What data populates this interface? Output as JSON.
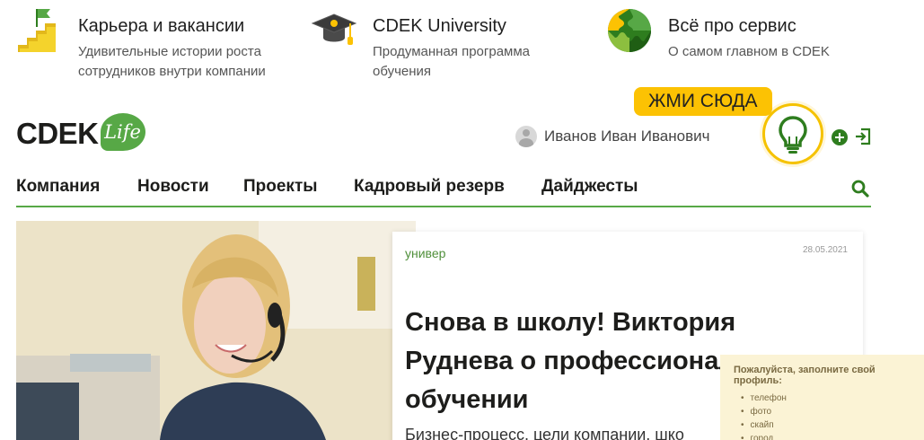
{
  "promos": [
    {
      "title": "Карьера и вакансии",
      "line1": "Удивительные истории роста",
      "line2": "сотрудников внутри компании",
      "icon": "stairs-flag-icon"
    },
    {
      "title": "CDEK University",
      "line1": "Продуманная программа",
      "line2": "обучения",
      "icon": "graduation-cap-icon"
    },
    {
      "title": "Всё про сервис",
      "line1": "О самом главном в CDEK",
      "line2": "",
      "icon": "puzzle-globe-icon"
    }
  ],
  "header": {
    "logo_text": "CDEK",
    "logo_badge": "Life",
    "user_name": "Иванов Иван Иванович",
    "tip_button": "ЖМИ СЮДА"
  },
  "nav": {
    "items": [
      "Компания",
      "Новости",
      "Проекты",
      "Кадровый резерв",
      "Дайджесты"
    ]
  },
  "article": {
    "category": "универ",
    "date": "28.05.2021",
    "headline": "Снова в школу! Виктория Руднева о профессиональном обучении",
    "lead": "Бизнес-процесс, цели компании, шко"
  },
  "profile_popup": {
    "title": "Пожалуйста, заполните свой профиль:",
    "items": [
      "телефон",
      "фото",
      "скайп",
      "город"
    ]
  },
  "colors": {
    "brand_green": "#57a846",
    "dark_green": "#2e7d1e",
    "accent_yellow": "#fcc203"
  }
}
